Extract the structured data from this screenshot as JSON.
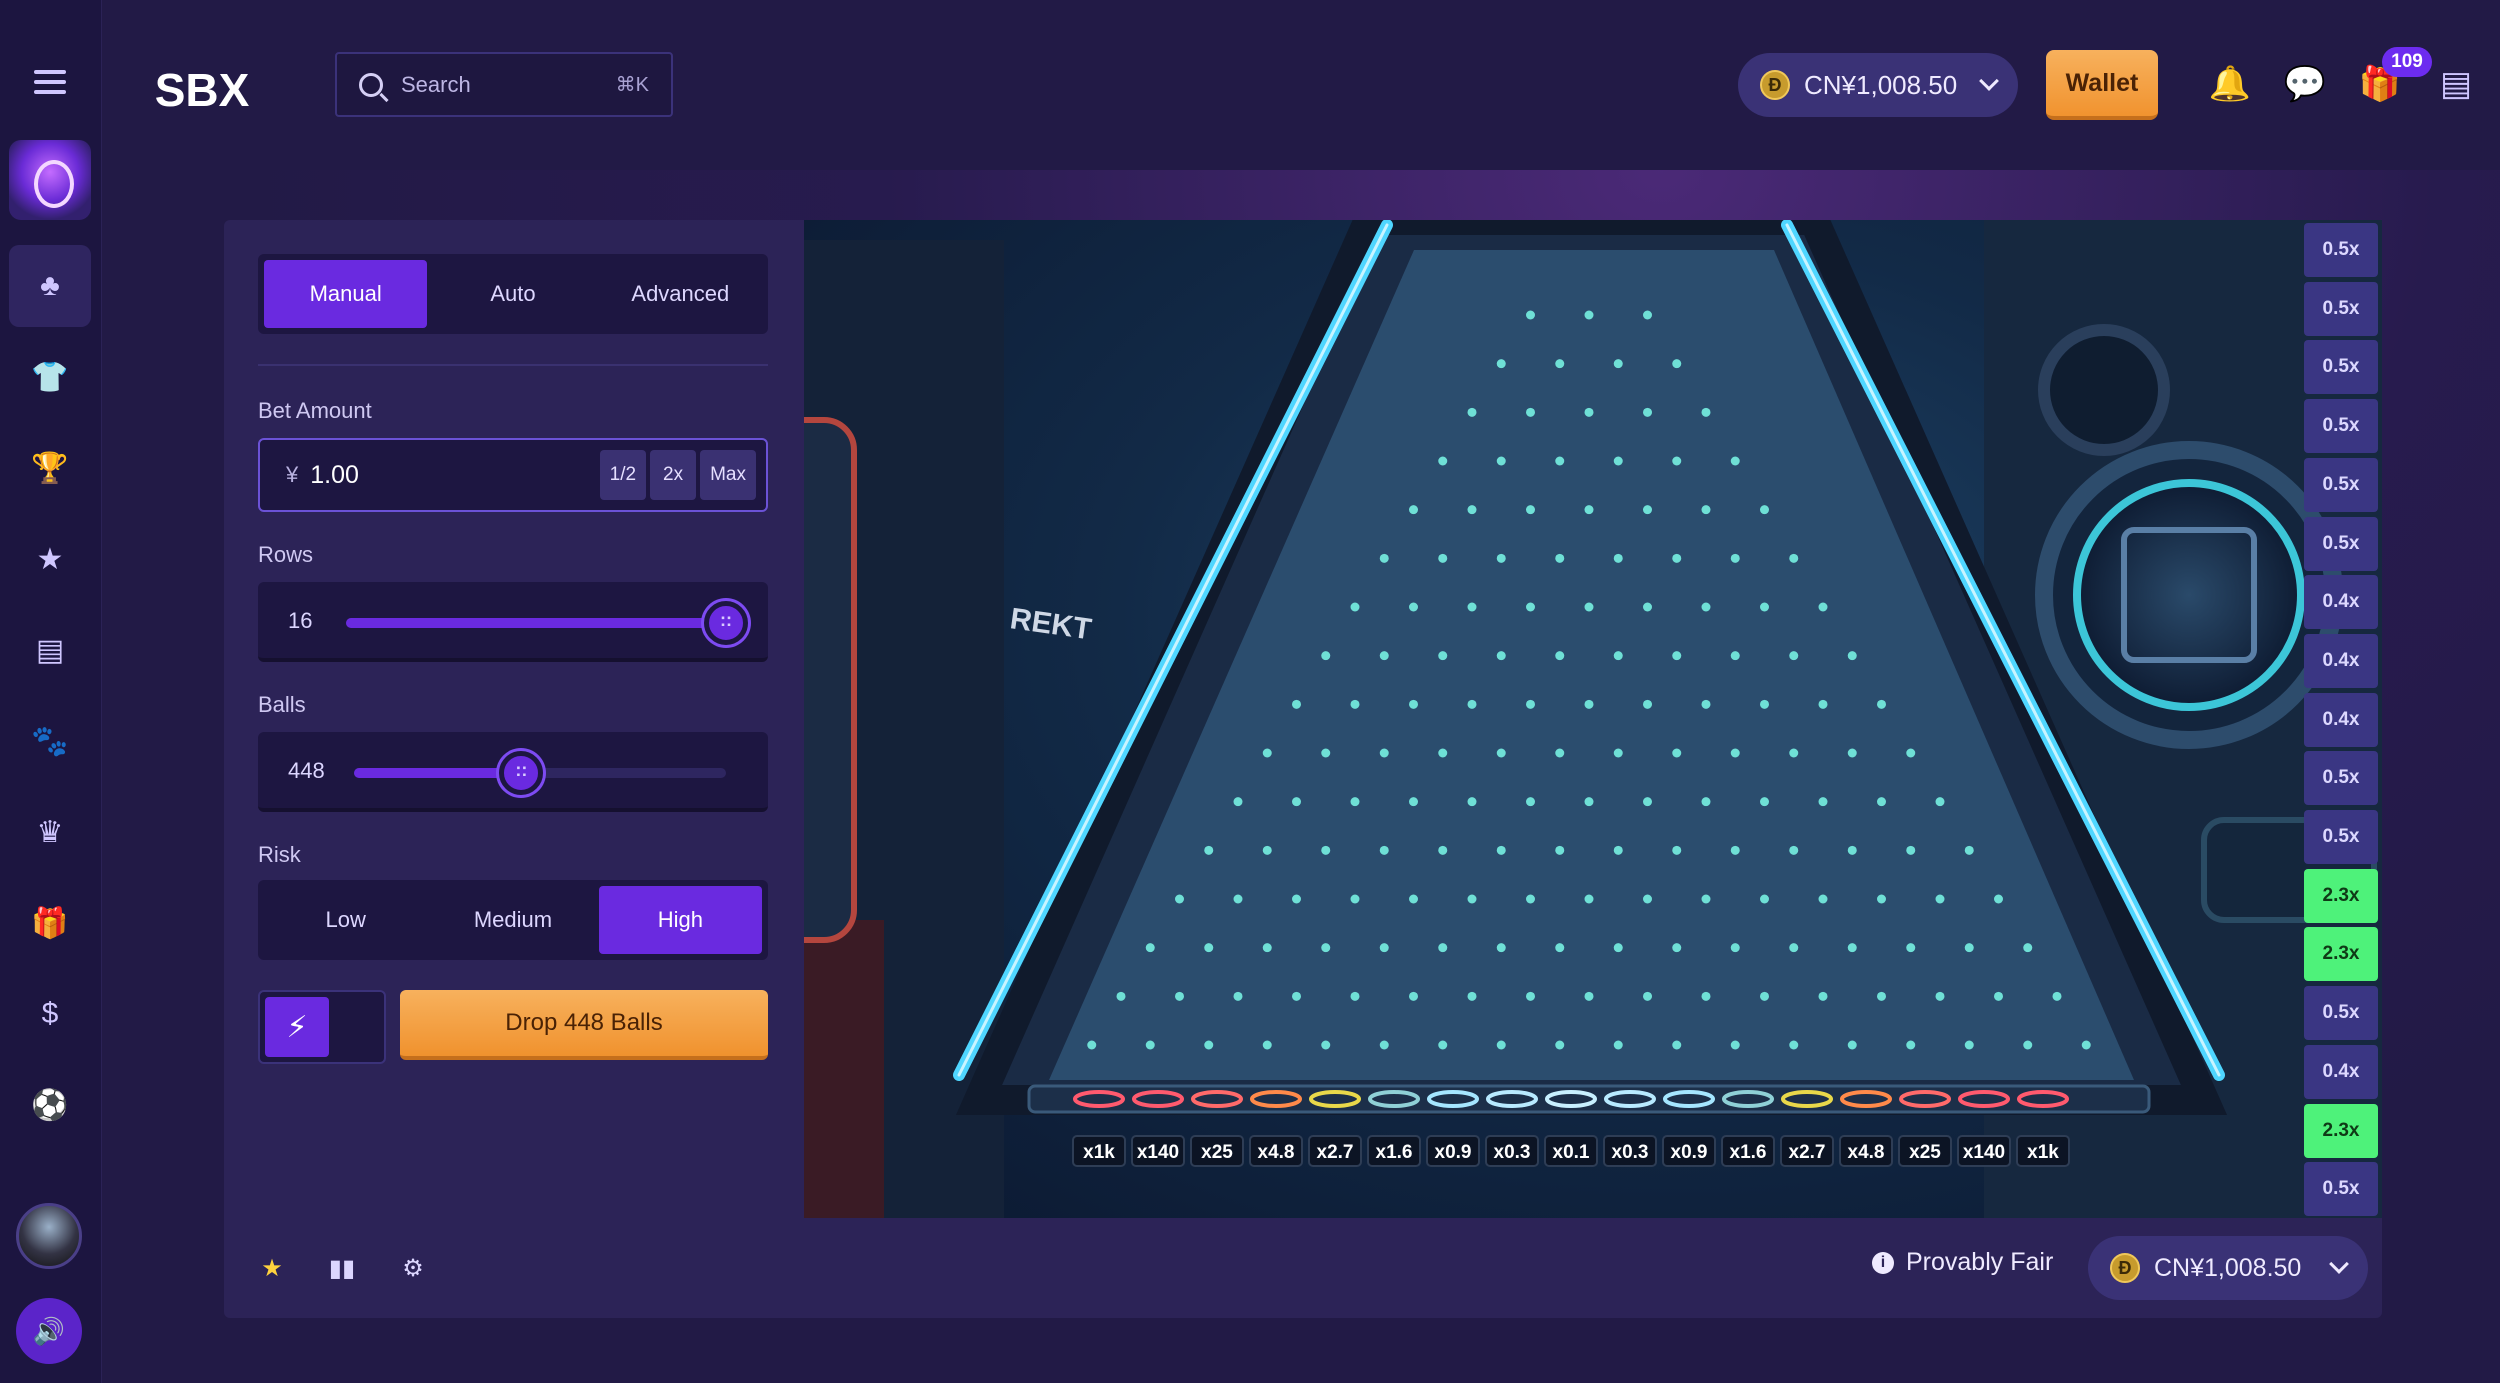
{
  "header": {
    "logo_text": "SBX",
    "search": {
      "placeholder": "Search",
      "shortcut": "⌘K"
    },
    "balance": {
      "coin": "Đ",
      "amount": "CN¥1,008.50"
    },
    "wallet_label": "Wallet",
    "gift_badge": "109"
  },
  "rail": {
    "items": [
      {
        "icon": "club-icon",
        "glyph": "♣",
        "active": true
      },
      {
        "icon": "shirt-icon",
        "glyph": "👕"
      },
      {
        "icon": "trophy-icon",
        "glyph": "🏆"
      },
      {
        "icon": "star-icon",
        "glyph": "★"
      },
      {
        "icon": "receipt-icon",
        "glyph": "▤"
      },
      {
        "icon": "paw-icon",
        "glyph": "🐾"
      },
      {
        "icon": "crown-icon",
        "glyph": "♛"
      },
      {
        "icon": "gift-icon",
        "glyph": "🎁"
      },
      {
        "icon": "dollar-icon",
        "glyph": "$"
      },
      {
        "icon": "soccer-icon",
        "glyph": "⚽"
      }
    ]
  },
  "panel": {
    "tabs": [
      "Manual",
      "Auto",
      "Advanced"
    ],
    "active_tab": "Manual",
    "bet": {
      "label": "Bet Amount",
      "currency": "¥",
      "value": "1.00",
      "half": "1/2",
      "double": "2x",
      "max": "Max"
    },
    "rows": {
      "label": "Rows",
      "value": "16",
      "level": 1.0
    },
    "balls": {
      "label": "Balls",
      "value": "448",
      "level": 0.45
    },
    "risk": {
      "label": "Risk",
      "options": [
        "Low",
        "Medium",
        "High"
      ],
      "selected": "High"
    },
    "drop_label": "Drop 448 Balls"
  },
  "board": {
    "slot_labels": [
      "x1k",
      "x140",
      "x25",
      "x4.8",
      "x2.7",
      "x1.6",
      "x0.9",
      "x0.3",
      "x0.1",
      "x0.3",
      "x0.9",
      "x1.6",
      "x2.7",
      "x4.8",
      "x25",
      "x140",
      "x1k"
    ],
    "graffiti": "REKT"
  },
  "history": [
    {
      "label": "0.5x",
      "hit": false
    },
    {
      "label": "0.5x",
      "hit": false
    },
    {
      "label": "0.5x",
      "hit": false
    },
    {
      "label": "0.5x",
      "hit": false
    },
    {
      "label": "0.5x",
      "hit": false
    },
    {
      "label": "0.5x",
      "hit": false
    },
    {
      "label": "0.4x",
      "hit": false
    },
    {
      "label": "0.4x",
      "hit": false
    },
    {
      "label": "0.4x",
      "hit": false
    },
    {
      "label": "0.5x",
      "hit": false
    },
    {
      "label": "0.5x",
      "hit": false
    },
    {
      "label": "2.3x",
      "hit": true
    },
    {
      "label": "2.3x",
      "hit": true
    },
    {
      "label": "0.5x",
      "hit": false
    },
    {
      "label": "0.4x",
      "hit": false
    },
    {
      "label": "2.3x",
      "hit": true
    },
    {
      "label": "0.5x",
      "hit": false
    }
  ],
  "footer": {
    "provably_fair": "Provably Fair",
    "balance": {
      "coin": "Đ",
      "amount": "CN¥1,008.50"
    }
  },
  "colors": {
    "accent": "#6a2ae0",
    "cta": "#f4a047",
    "hit": "#4ef27a",
    "neon": "#4fd6ff"
  }
}
